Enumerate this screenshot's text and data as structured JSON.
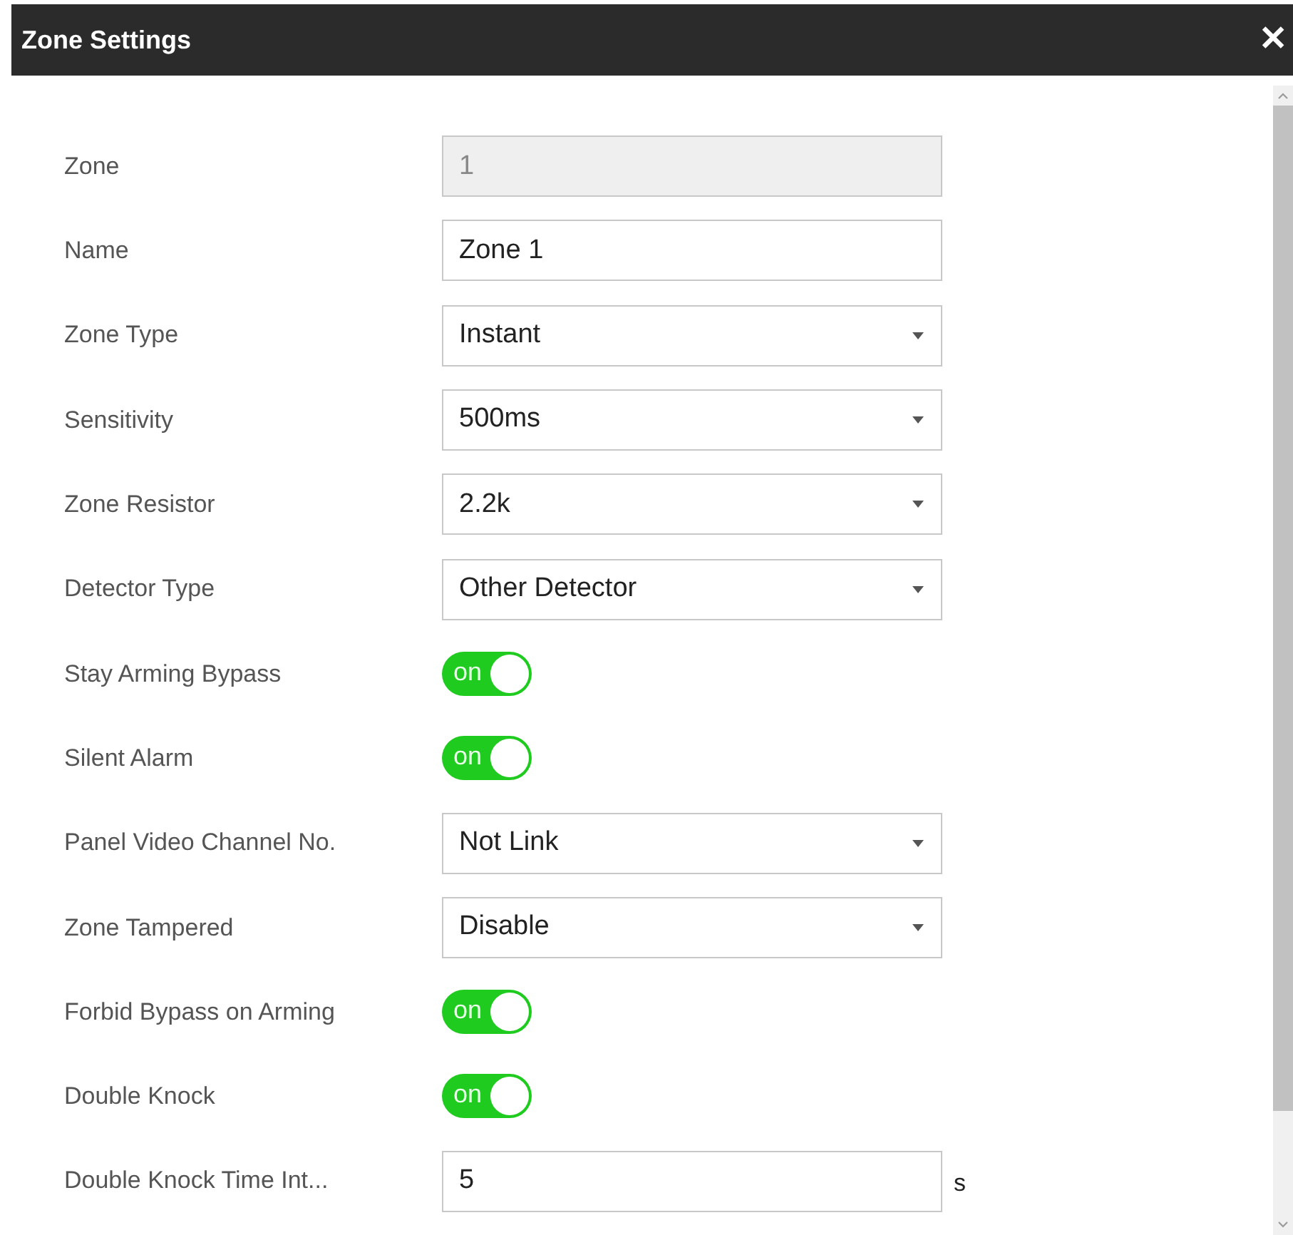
{
  "window": {
    "title": "Zone Settings",
    "close": "✕"
  },
  "fields": [
    {
      "label": "Zone",
      "kind": "text",
      "value": "1",
      "disabled": true
    },
    {
      "label": "Name",
      "kind": "text",
      "value": "Zone 1",
      "disabled": false
    },
    {
      "label": "Zone Type",
      "kind": "select",
      "value": "Instant"
    },
    {
      "label": "Sensitivity",
      "kind": "select",
      "value": "500ms"
    },
    {
      "label": "Zone Resistor",
      "kind": "select",
      "value": "2.2k"
    },
    {
      "label": "Detector Type",
      "kind": "select",
      "value": "Other Detector"
    },
    {
      "label": "Stay Arming Bypass",
      "kind": "toggle",
      "on": true,
      "text": "on"
    },
    {
      "label": "Silent Alarm",
      "kind": "toggle",
      "on": true,
      "text": "on"
    },
    {
      "label": "Panel Video Channel No.",
      "kind": "select",
      "value": "Not Link"
    },
    {
      "label": "Zone Tampered",
      "kind": "select",
      "value": "Disable"
    },
    {
      "label": "Forbid Bypass on Arming",
      "kind": "toggle",
      "on": true,
      "text": "on"
    },
    {
      "label": "Double Knock",
      "kind": "toggle",
      "on": true,
      "text": "on"
    },
    {
      "label": "Double Knock Time Int...",
      "kind": "text",
      "value": "5",
      "disabled": false,
      "unit": "s"
    }
  ]
}
